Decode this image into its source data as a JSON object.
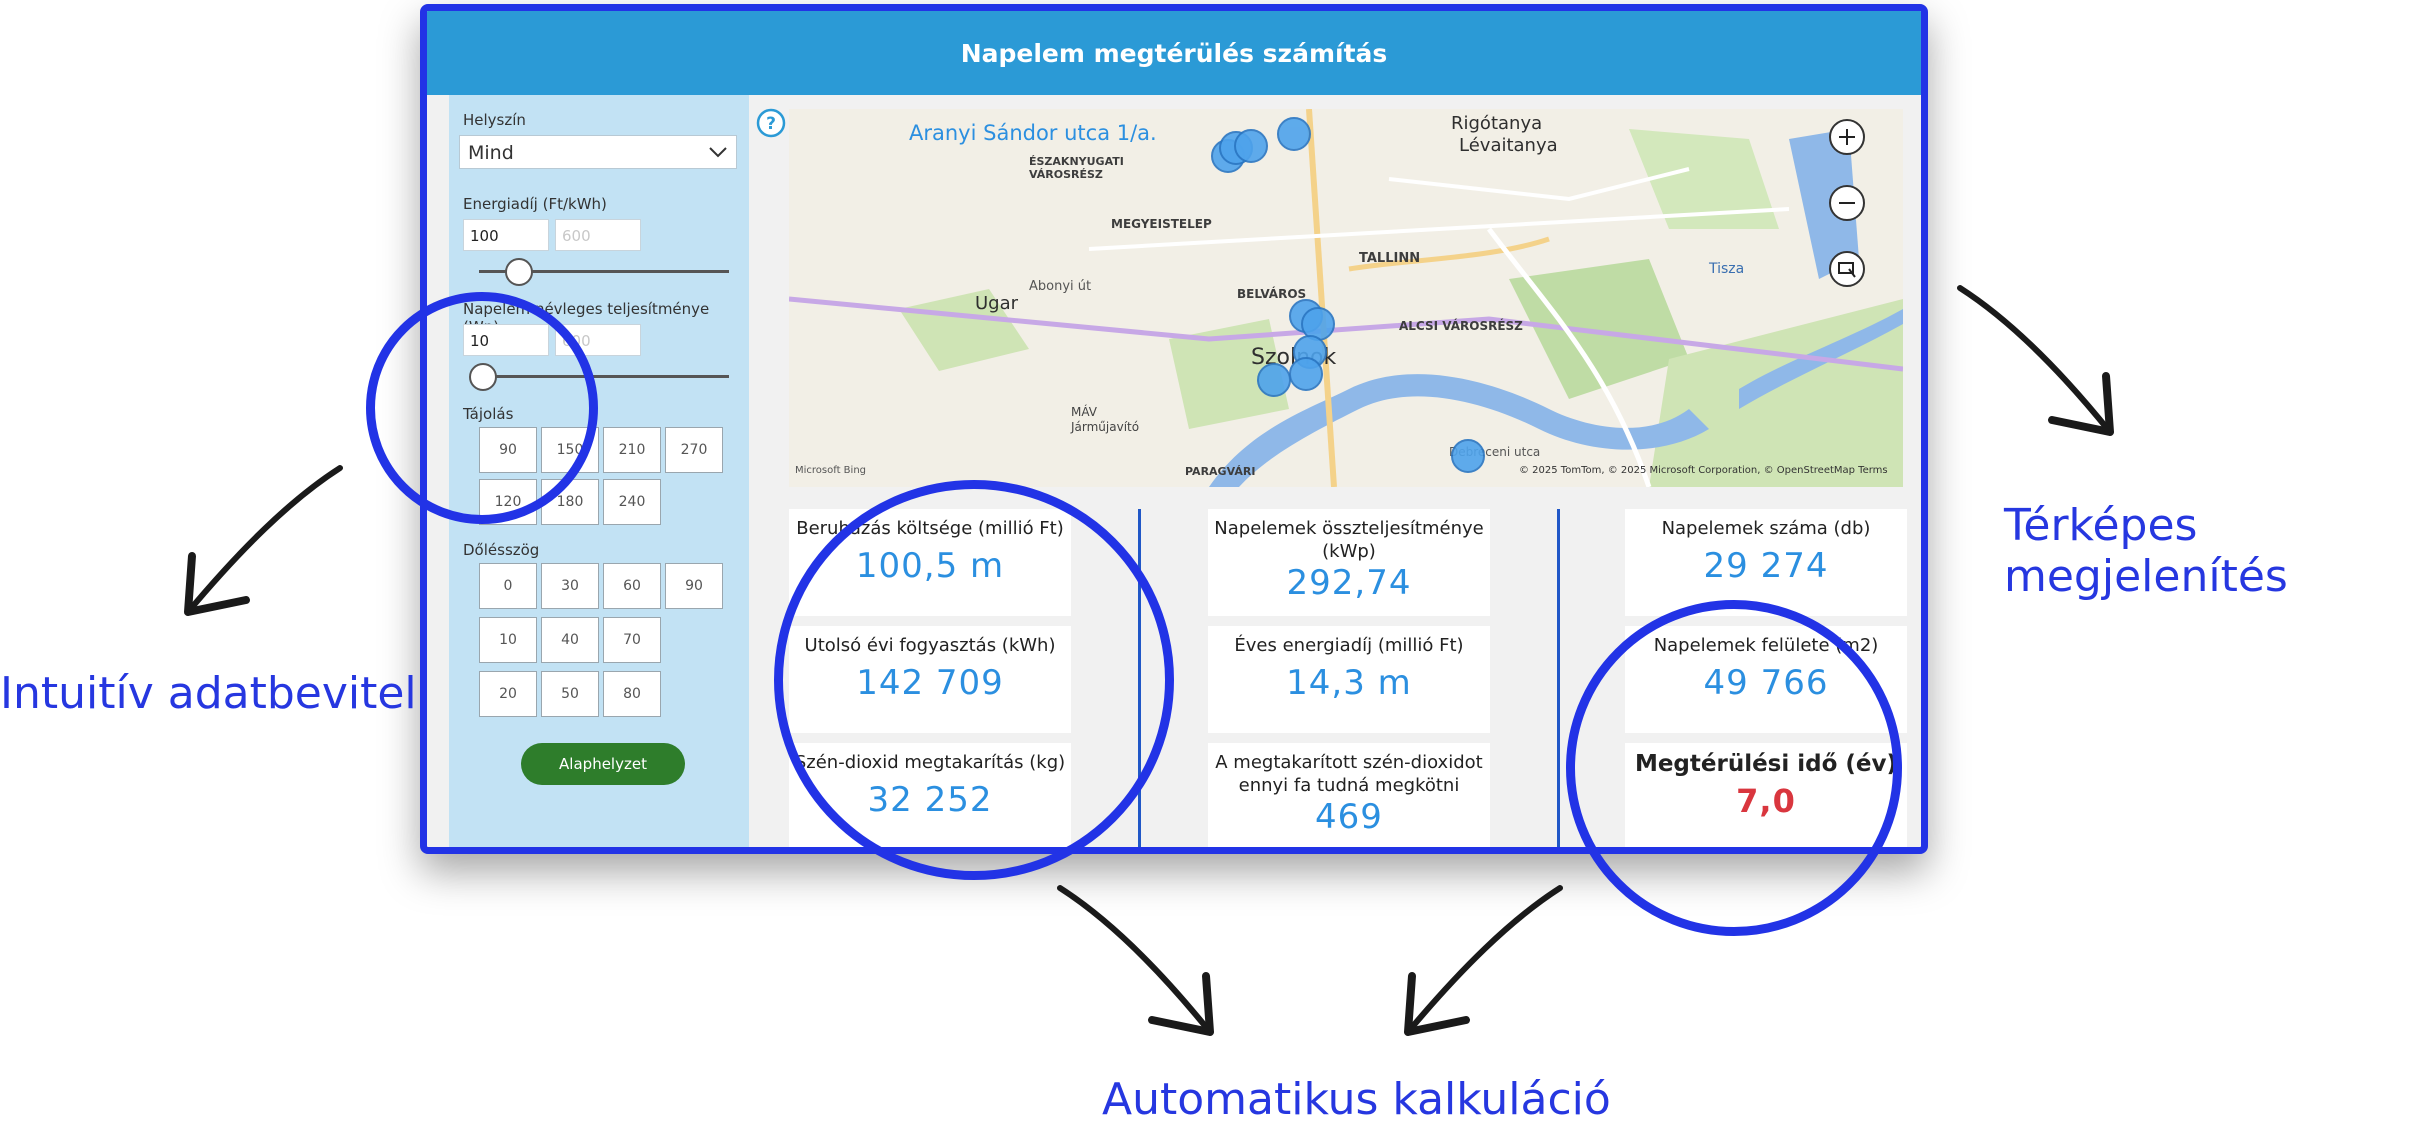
{
  "title": "Napelem megtérülés számítás",
  "help_icon": "question-circle-icon",
  "sidebar": {
    "location_label": "Helyszín",
    "location_value": "Mind",
    "energy_label": "Energiadíj (Ft/kWh)",
    "energy_min": "100",
    "energy_max": "600",
    "power_label": "Napelem névleges teljesítménye (Wp)",
    "power_min": "10",
    "power_max": "600",
    "orientation_label": "Tájolás",
    "orientation_options": [
      "90",
      "150",
      "210",
      "270",
      "120",
      "180",
      "240"
    ],
    "tilt_label": "Dőlésszög",
    "tilt_options": [
      "0",
      "30",
      "60",
      "90",
      "10",
      "40",
      "70",
      "20",
      "50",
      "80"
    ],
    "reset_label": "Alaphelyzet"
  },
  "map": {
    "address": "Aranyi Sándor utca 1/a.",
    "labels": [
      "ÉSZAKNYUGATI VÁROSRÉSZ",
      "MEGYEISTELEP",
      "TALLINN",
      "BELVÁROS",
      "ALCSI VÁROSRÉSZ",
      "MÁV Járműjavító",
      "PARAGVÁRI",
      "Szolnok",
      "Ugar",
      "Rigótanya",
      "Lévaitanya",
      "Tisza",
      "Abonyi út",
      "Debreceni utca"
    ],
    "attribution": "© 2025 TomTom, © 2025 Microsoft Corporation, © OpenStreetMap  Terms",
    "logo": "Microsoft Bing"
  },
  "kpis": [
    {
      "title": "Beruházás költsége (millió Ft)",
      "value": "100,5 m"
    },
    {
      "title": "Utolsó évi fogyasztás (kWh)",
      "value": "142 709"
    },
    {
      "title": "Szén-dioxid megtakarítás (kg)",
      "value": "32 252"
    },
    {
      "title": "Napelemek összteljesítménye (kWp)",
      "value": "292,74"
    },
    {
      "title": "Éves energiadíj (millió Ft)",
      "value": "14,3 m"
    },
    {
      "title": "A megtakarított szén-dioxidot ennyi fa tudná megkötni",
      "value": "469"
    },
    {
      "title": "Napelemek száma (db)",
      "value": "29 274"
    },
    {
      "title": "Napelemek felülete (m2)",
      "value": "49 766"
    },
    {
      "title": "Megtérülési idő (év)",
      "value": "7,0"
    }
  ],
  "annotations": {
    "left": "Intuitív adatbevitel",
    "right": "Térképes megjelenítés",
    "bottom": "Automatikus kalkuláció"
  },
  "colors": {
    "accent": "#2b9ad6",
    "annotation": "#2233e6",
    "kpi_value": "#2b8fe0",
    "payback_value": "#d9363e",
    "reset_button": "#2e7d2b"
  }
}
